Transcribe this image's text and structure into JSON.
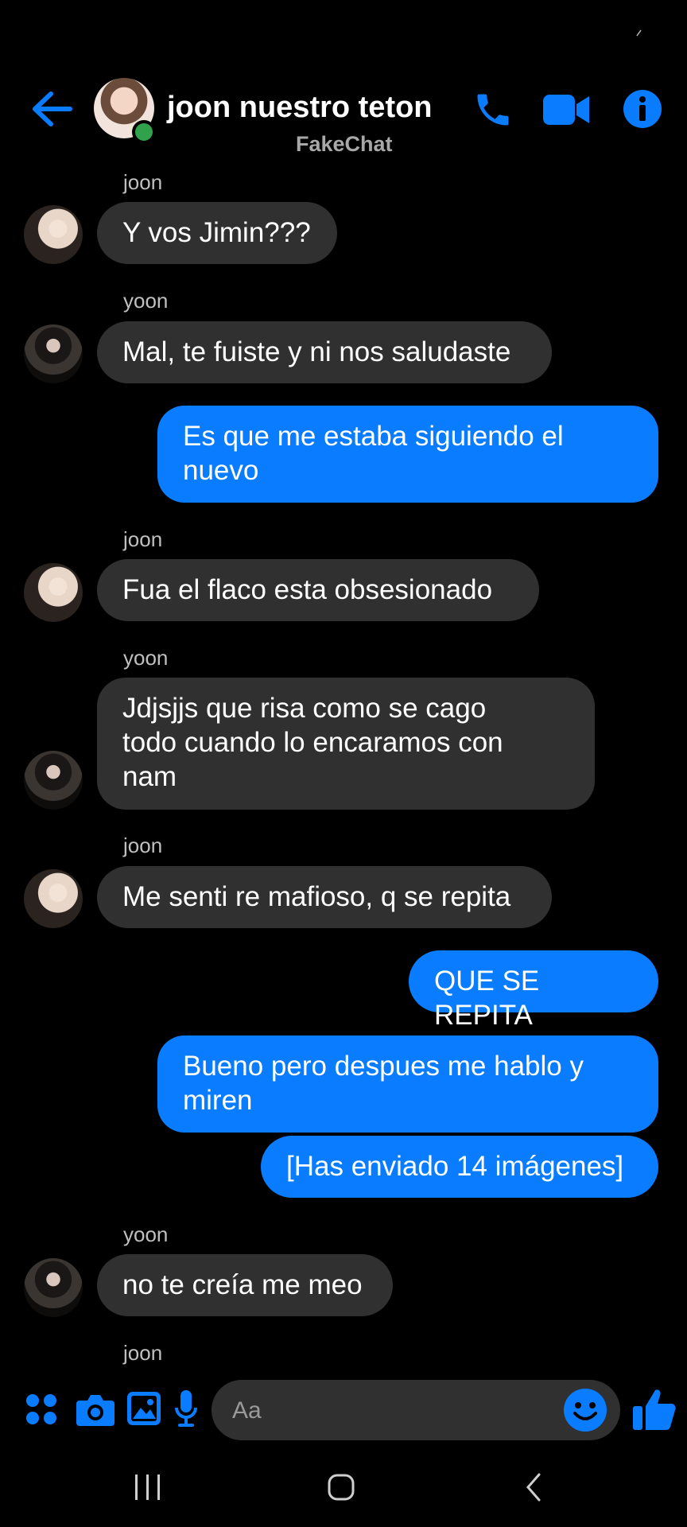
{
  "header": {
    "title": "joon nuestro teton",
    "subtitle": "FakeChat"
  },
  "messages": [
    {
      "sender": "joon",
      "text": "Y vos Jimin???"
    },
    {
      "sender": "yoon",
      "text": "Mal, te fuiste y ni nos saludaste"
    },
    {
      "line1": "Es que me estaba siguiendo el",
      "line2": "nuevo"
    },
    {
      "sender": "joon",
      "text": "Fua el flaco esta obsesionado"
    },
    {
      "sender": "yoon",
      "line1": "Jdjsjjs que risa como se cago",
      "line2": "todo cuando lo encaramos con",
      "line3": "nam"
    },
    {
      "sender": "joon",
      "text": "Me senti re mafioso, q se repita"
    },
    {
      "text": "QUE SE REPITA"
    },
    {
      "line1": "Bueno pero despues me hablo y",
      "line2": "miren"
    },
    {
      "text": "[Has enviado 14 imágenes]"
    },
    {
      "sender": "yoon",
      "text": "no te creía me meo"
    },
    {
      "sender": "joon"
    }
  ],
  "composer": {
    "placeholder": "Aa"
  },
  "icons": {
    "back": "arrow-left-icon",
    "call": "phone-icon",
    "video": "video-camera-icon",
    "info": "info-icon",
    "apps": "four-dots-icon",
    "camera": "camera-icon",
    "gallery": "image-icon",
    "mic": "microphone-icon",
    "emoji": "smiley-icon",
    "like": "thumbs-up-icon",
    "nav_recents": "recents-icon",
    "nav_home": "home-icon",
    "nav_back": "chevron-left-icon"
  },
  "colors": {
    "accent": "#0a7cff",
    "incoming_bubble": "#303030",
    "online": "#31a24c"
  }
}
